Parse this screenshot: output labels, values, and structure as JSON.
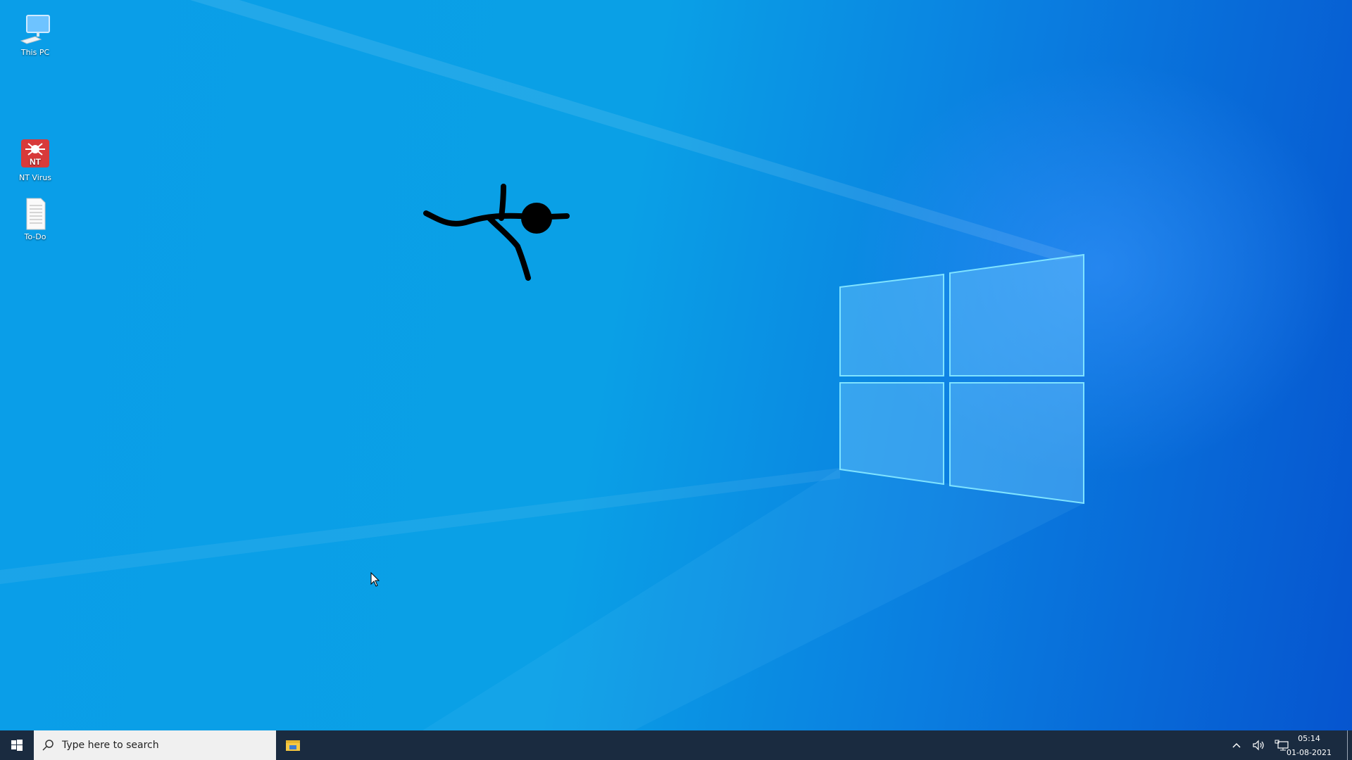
{
  "desktop": {
    "icons": [
      {
        "label": "This PC",
        "icon": "computer-icon"
      },
      {
        "label": "NT Virus",
        "icon": "spider-icon",
        "badge": "NT",
        "color": "#d83a3a"
      },
      {
        "label": "To-Do",
        "icon": "text-file-icon"
      }
    ],
    "overlay": "stick-figure"
  },
  "taskbar": {
    "start_icon": "windows-icon",
    "search_placeholder": "Type here to search",
    "pinned": [
      {
        "name": "File Explorer",
        "icon": "folder-icon"
      }
    ],
    "tray": {
      "overflow_icon": "chevron-up-icon",
      "volume_icon": "speaker-icon",
      "network_icon": "network-icon",
      "time": "05:14",
      "date": "01-08-2021"
    }
  },
  "colors": {
    "taskbar": "#1a2b40",
    "desktop": "#0a9ee8",
    "virus_red": "#d83a3a"
  }
}
